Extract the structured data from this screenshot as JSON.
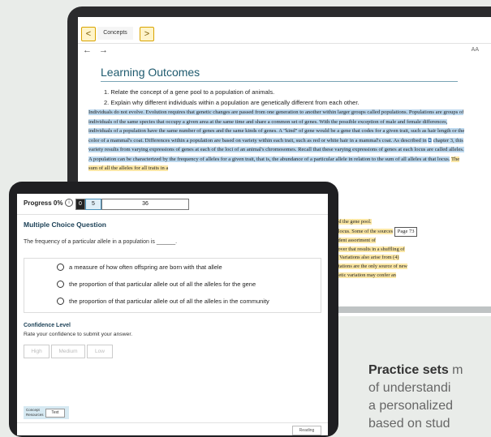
{
  "laptop": {
    "tab_prev_arrow": "<",
    "tab_label": "Concepts",
    "tab_next_arrow": ">",
    "nav_back": "←",
    "nav_forward": "→",
    "font_size_label": "AA",
    "outcomes_title": "Learning Outcomes",
    "outcomes": [
      "1. Relate the concept of a gene pool to a population of animals.",
      "2. Explain why different individuals within a population are genetically different from each other."
    ],
    "reading_text": "Individuals do not evolve. Evolution requires that genetic changes are passed from one generation to another within larger groups called populations. Populations are groups of individuals of the same species that occupy a given area at the same time and share a common set of genes. With the possible exception of male and female differences, individuals of a population have the same number of genes and the same kinds of genes. A \"kind\" of gene would be a gene that codes for a given trait, such as hair length or the color of a mammal's coat. Differences within a population are based on variety within each trait, such as red or white hair in a mammal's coat. As described in",
    "reading_text_2": "chapter 3, this variety results from varying expressions of genes at each of the loci of an animal's chromosomes. Recall that these varying expressions of genes at each locus are called alleles. A population can be characterized by the frequency of alleles for a given trait, that is, the abundance of a particular allele in relation to the sum of all alleles at that locus.",
    "reading_text_3": "The sum of all the alleles for all traits in a",
    "reading_right_1": "and is called the gene pool.",
    "reading_right_2": "les at each locus. Some of the sources",
    "page_ref": "Page 73",
    "reading_right_3": "he independent assortment of",
    "reading_right_4": "e crossing-over that results in a shuffling of",
    "reading_right_5": "sperm cell. Variations also arise from (4)",
    "reading_right_6": "alleles. Mutations are the only source of new",
    "reading_right_7": "es how genetic variation may confer an"
  },
  "tablet": {
    "progress_label": "Progress 0%",
    "info_icon": "i",
    "progress_values": [
      "0",
      "5",
      "36"
    ],
    "progress_fraction": 0,
    "question_title": "Multiple Choice Question",
    "question_text": "The frequency of a particular allele in a population is ______.",
    "options": [
      "a measure of how often offspring are born with that allele",
      "the proportion of that particular allele out of all the alleles for the gene",
      "the proportion of that particular allele out of all the alleles in the community"
    ],
    "confidence_title": "Confidence Level",
    "confidence_sub": "Rate your confidence to submit your answer.",
    "confidence_buttons": [
      "High",
      "Medium",
      "Low"
    ],
    "concept_resources": "Concept Resources",
    "text_button": "Text",
    "reading_button": "Reading"
  },
  "marketing": {
    "line1_bold": "Practice sets",
    "line1_rest": " m",
    "line2": "of understandi",
    "line3": "a personalized",
    "line4": "based on stud"
  },
  "colors": {
    "highlight_blue": "#bcd8ee",
    "highlight_yellow": "#fbe7a6",
    "heading_teal": "#1e5a6e"
  }
}
